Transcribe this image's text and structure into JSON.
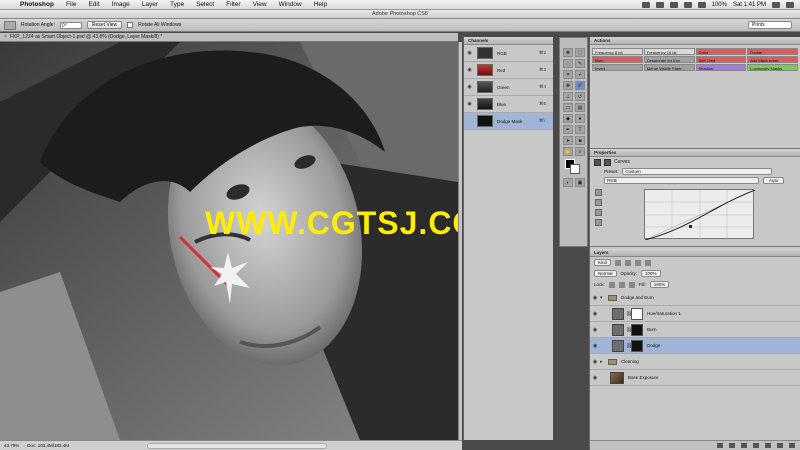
{
  "menubar": {
    "apple": "",
    "items": [
      "Photoshop",
      "File",
      "Edit",
      "Image",
      "Layer",
      "Type",
      "Select",
      "Filter",
      "View",
      "Window",
      "Help"
    ],
    "battery": "100%",
    "clock": "Sat 1:41 PM"
  },
  "window": {
    "title": "Adobe Photoshop CS6"
  },
  "options": {
    "rotation_label": "Rotation Angle:",
    "rotation_value": "0°",
    "reset_view": "Reset View",
    "rotate_all": "Rotate All Windows",
    "workspace": "Prints"
  },
  "document": {
    "tab_title": "FKP_1224 as Smart Object-1.psd @ 43.8% (Dodge, Layer Mask/8) *",
    "watermark": "WWW.CGTSJ.COM"
  },
  "statusbar": {
    "zoom": "43.79%",
    "doc": "Doc: 103.4M/183.4M"
  },
  "channels": {
    "tab": "Channels",
    "rows": [
      {
        "name": "RGB",
        "shortcut": "⌘2",
        "thumb": "rgb"
      },
      {
        "name": "Red",
        "shortcut": "⌘3",
        "thumb": "red"
      },
      {
        "name": "Green",
        "shortcut": "⌘4",
        "thumb": "green"
      },
      {
        "name": "Blue",
        "shortcut": "⌘5",
        "thumb": "blue"
      },
      {
        "name": "Dodge Mask",
        "shortcut": "⌘\\",
        "thumb": "mask",
        "selected": true
      }
    ]
  },
  "actions": {
    "tab": "Actions",
    "items": [
      {
        "label": "Frequency 8 bit",
        "color": "none"
      },
      {
        "label": "Frequency 16 bit",
        "color": "none"
      },
      {
        "label": "Color",
        "color": "red"
      },
      {
        "label": "Dodge",
        "color": "red"
      },
      {
        "label": "Burn",
        "color": "red"
      },
      {
        "label": "Desaturate for Eye",
        "color": "gray"
      },
      {
        "label": "Soft Light",
        "color": "red"
      },
      {
        "label": "Add black mask",
        "color": "red"
      },
      {
        "label": "Invert",
        "color": "gray"
      },
      {
        "label": "Merge Visible Stam...",
        "color": "gray"
      },
      {
        "label": "Shadow",
        "color": "violet"
      },
      {
        "label": "Luminosity Masks",
        "color": "green"
      }
    ]
  },
  "properties": {
    "tab": "Properties",
    "title": "Curves",
    "preset_label": "Preset:",
    "preset_value": "Custom",
    "channel_value": "RGB",
    "auto": "Auto"
  },
  "layers": {
    "tab": "Layers",
    "kind": "Kind",
    "blend": "Normal",
    "opacity_label": "Opacity:",
    "opacity": "100%",
    "lock_label": "Lock:",
    "fill_label": "Fill:",
    "fill": "100%",
    "rows": [
      {
        "name": "Dodge and Burn",
        "type": "group-open"
      },
      {
        "name": "Hue/Saturation 1",
        "type": "adj",
        "mask": "white"
      },
      {
        "name": "Burn",
        "type": "adj",
        "mask": "black"
      },
      {
        "name": "Dodge",
        "type": "adj",
        "mask": "black",
        "selected": true
      },
      {
        "name": "Cleaning",
        "type": "group-closed"
      },
      {
        "name": "Base Exposure",
        "type": "photo"
      }
    ]
  }
}
